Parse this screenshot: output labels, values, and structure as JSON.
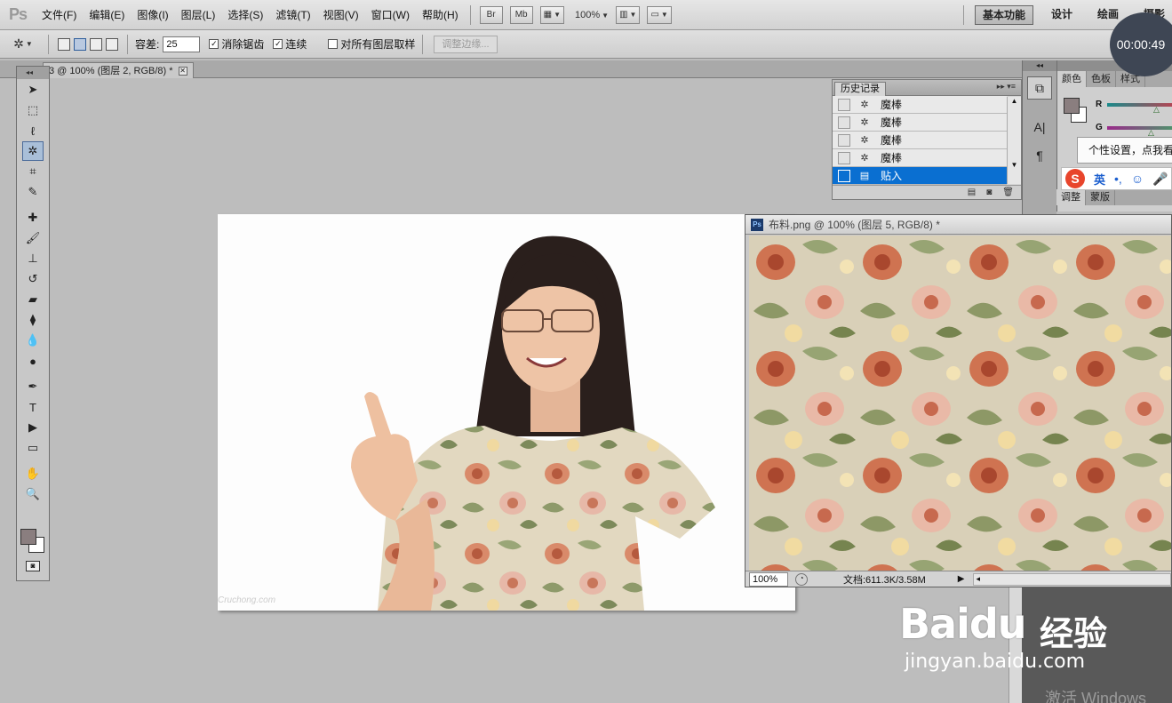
{
  "app": {
    "logo": "Ps"
  },
  "menu": [
    "文件(F)",
    "编辑(E)",
    "图像(I)",
    "图层(L)",
    "选择(S)",
    "滤镜(T)",
    "视图(V)",
    "窗口(W)",
    "帮助(H)"
  ],
  "menubar_buttons": {
    "bridge": "Br",
    "minibridge": "Mb",
    "zoom": "100%"
  },
  "workspaces": {
    "active": "基本功能",
    "design": "设计",
    "painting": "绘画",
    "photography": "摄影"
  },
  "timer": "00:00:49",
  "options": {
    "tolerance_label": "容差:",
    "tolerance_value": "25",
    "antialias_label": "消除锯齿",
    "contiguous_label": "连续",
    "sample_all_label": "对所有图层取样",
    "refine_edge": "调整边缘..."
  },
  "document_tab": {
    "title": "3 @ 100% (图层 2, RGB/8) *"
  },
  "history": {
    "title": "历史记录",
    "rows": [
      {
        "label": "魔棒",
        "selected": false
      },
      {
        "label": "魔棒",
        "selected": false
      },
      {
        "label": "魔棒",
        "selected": false
      },
      {
        "label": "魔棒",
        "selected": false
      },
      {
        "label": "贴入",
        "selected": true
      }
    ]
  },
  "right_panel": {
    "tabs": [
      "颜色",
      "色板",
      "样式"
    ],
    "channel_r": "R",
    "channel_g": "G",
    "adjust_tabs": [
      "调整",
      "蒙版"
    ]
  },
  "tooltip": "个性设置，点我看",
  "ime": {
    "lang": "英"
  },
  "fabric_window": {
    "title": "布料.png @ 100% (图层 5, RGB/8) *",
    "zoom": "100%",
    "doc_info": "文档:611.3K/3.58M"
  },
  "canvas": {
    "watermark": "Cruchong.com"
  },
  "baidu": {
    "logo_latin": "Baidu",
    "logo_cn": "经验",
    "url": "jingyan.baidu.com"
  },
  "activate_windows": "激活 Windows",
  "colors": {
    "foreground": "#8a7e7f",
    "background": "#ffffff",
    "selection_blue": "#0a6fd1"
  }
}
